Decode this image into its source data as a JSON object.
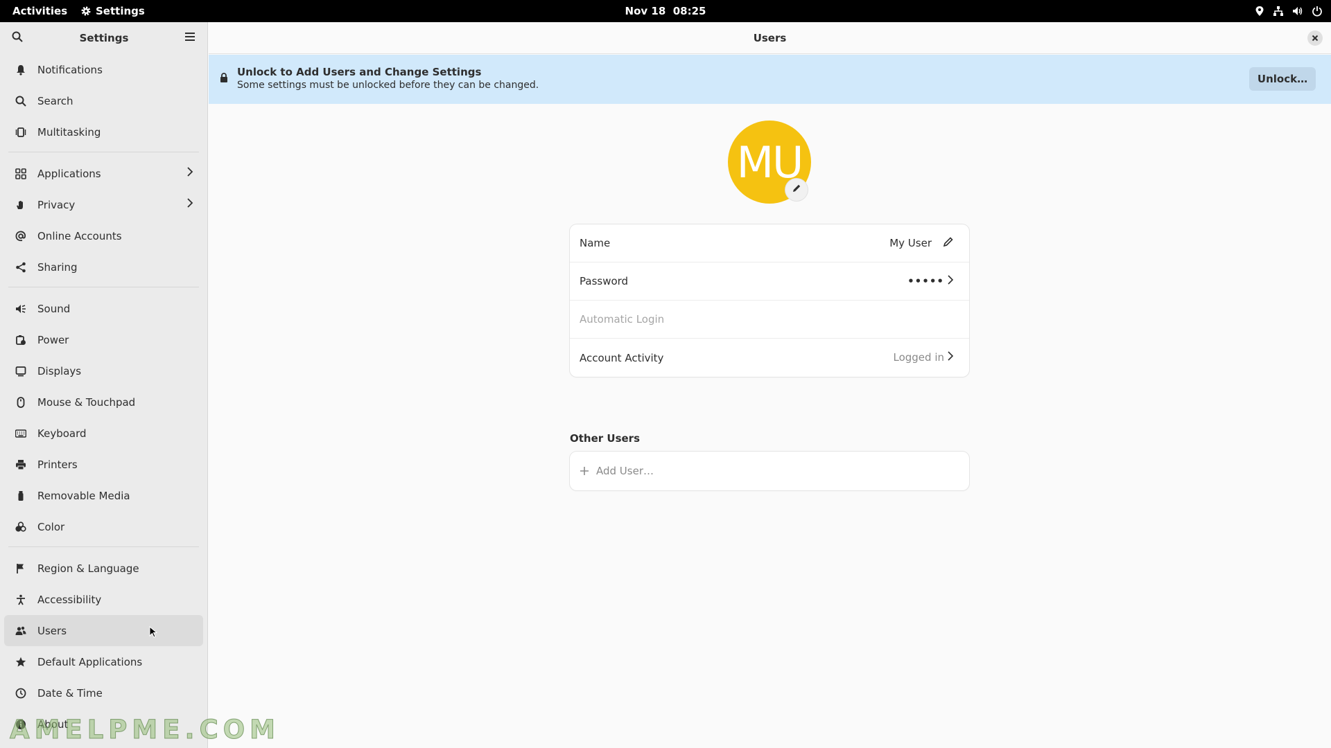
{
  "topbar": {
    "activities": "Activities",
    "app_name": "Settings",
    "date": "Nov 18",
    "time": "08:25"
  },
  "sidebar": {
    "title": "Settings",
    "groups": [
      [
        {
          "label": "Notifications",
          "icon": "bell-icon"
        },
        {
          "label": "Search",
          "icon": "search-icon"
        },
        {
          "label": "Multitasking",
          "icon": "multitasking-icon"
        }
      ],
      [
        {
          "label": "Applications",
          "icon": "applications-icon",
          "has_submenu": true
        },
        {
          "label": "Privacy",
          "icon": "hand-icon",
          "has_submenu": true
        },
        {
          "label": "Online Accounts",
          "icon": "at-icon"
        },
        {
          "label": "Sharing",
          "icon": "share-icon"
        }
      ],
      [
        {
          "label": "Sound",
          "icon": "speaker-icon"
        },
        {
          "label": "Power",
          "icon": "battery-icon"
        },
        {
          "label": "Displays",
          "icon": "display-icon"
        },
        {
          "label": "Mouse & Touchpad",
          "icon": "mouse-icon"
        },
        {
          "label": "Keyboard",
          "icon": "keyboard-icon"
        },
        {
          "label": "Printers",
          "icon": "printer-icon"
        },
        {
          "label": "Removable Media",
          "icon": "usb-icon"
        },
        {
          "label": "Color",
          "icon": "color-icon"
        }
      ],
      [
        {
          "label": "Region & Language",
          "icon": "flag-icon"
        },
        {
          "label": "Accessibility",
          "icon": "accessibility-icon"
        },
        {
          "label": "Users",
          "icon": "users-icon",
          "active": true
        },
        {
          "label": "Default Applications",
          "icon": "star-icon"
        },
        {
          "label": "Date & Time",
          "icon": "clock-icon"
        },
        {
          "label": "About",
          "icon": "info-icon"
        }
      ]
    ]
  },
  "main": {
    "title": "Users",
    "banner": {
      "title": "Unlock to Add Users and Change Settings",
      "subtitle": "Some settings must be unlocked before they can be changed.",
      "button": "Unlock…"
    },
    "avatar": {
      "initials": "MU",
      "color": "#f5c211"
    },
    "user_rows": {
      "name_label": "Name",
      "name_value": "My User",
      "password_label": "Password",
      "password_value": "•••••",
      "autologin_label": "Automatic Login",
      "activity_label": "Account Activity",
      "activity_value": "Logged in"
    },
    "other_users_title": "Other Users",
    "add_user_label": "Add User…"
  },
  "watermark": "AMELPME.COM",
  "colors": {
    "banner": "#d1e9fb",
    "avatar": "#f5c211",
    "topbar": "#000000"
  }
}
